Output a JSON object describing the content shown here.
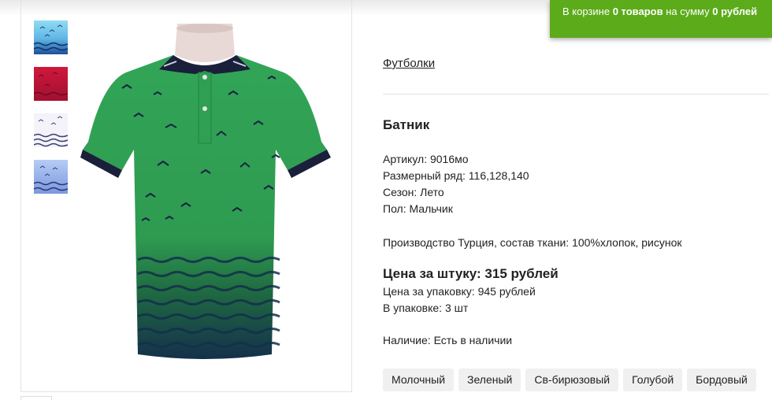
{
  "cart": {
    "prefix": "В корзине",
    "items_count": "0 товаров",
    "middle": "на сумму",
    "total": "0 рублей"
  },
  "thumbnails": [
    {
      "name": "thumb-light-blue",
      "colors": [
        "#7fd0ee",
        "#1d5fa8"
      ]
    },
    {
      "name": "thumb-red",
      "colors": [
        "#c8163a",
        "#8a0f2a"
      ]
    },
    {
      "name": "thumb-white",
      "colors": [
        "#f4f4fa",
        "#3a3f70"
      ]
    },
    {
      "name": "thumb-blue",
      "colors": [
        "#a9c2f2",
        "#3c4d9a"
      ]
    }
  ],
  "product_image": {
    "main_color": "#2e9a4f",
    "collar_color": "#1a1f3a"
  },
  "breadcrumb": "Футболки",
  "product": {
    "title": "Батник",
    "specs": [
      "Артикул: 9016мо",
      "Размерный ряд: 116,128,140",
      "Сезон: Лето",
      "Пол: Мальчик"
    ],
    "description": "Производство Турция, состав ткани: 100%хлопок, рисунок",
    "price_per_piece": "Цена за штуку: 315 рублей",
    "price_per_pack": "Цена за упаковку: 945 рублей",
    "pack_quantity": "В упаковке: 3 шт",
    "availability": "Наличие: Есть в наличии"
  },
  "color_options": [
    "Молочный",
    "Зеленый",
    "Св-бирюзовый",
    "Голубой",
    "Бордовый"
  ],
  "theme": {
    "accent": "#5cab1a"
  }
}
